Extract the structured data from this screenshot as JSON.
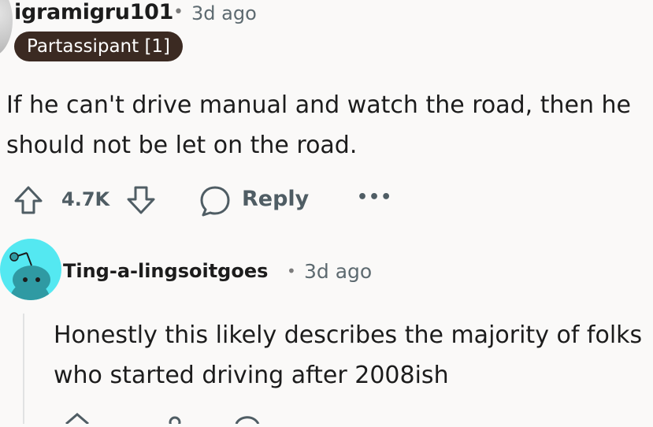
{
  "comment1": {
    "username": "igramigru101",
    "separator": "•",
    "time": "3d ago",
    "flair": "Partassipant [1]",
    "body_line1": "If he can't drive manual and watch the road, then he",
    "body_line2": "should not be let on the road.",
    "score": "4.7K",
    "reply_label": "Reply",
    "more_label": "•••"
  },
  "comment2": {
    "username": "Ting-a-lingsoitgoes",
    "separator": "•",
    "time": "3d ago",
    "body_line1": "Honestly this likely describes the majority of folks",
    "body_line2": "who started driving after 2008ish"
  },
  "colors": {
    "background": "#faf9f8",
    "flair_bg": "#3b2a22",
    "avatar2_bg": "#54e8f1",
    "meta_text": "#5d6a70",
    "action_text": "#4f5d64"
  },
  "icons": [
    "upvote-icon",
    "downvote-icon",
    "comment-bubble-icon",
    "more-options-icon",
    "snoo-avatar-icon"
  ]
}
